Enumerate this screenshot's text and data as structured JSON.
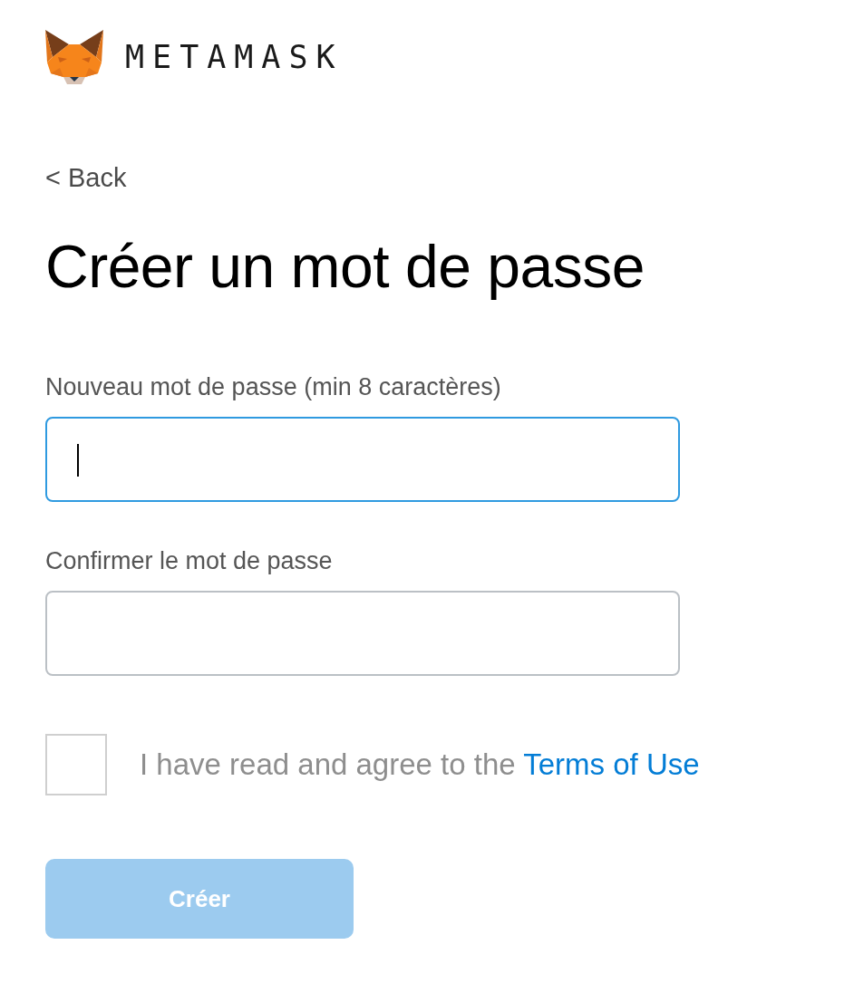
{
  "header": {
    "brand": "METAMASK"
  },
  "back_link": "< Back",
  "title": "Créer un mot de passe",
  "fields": [
    {
      "label": "Nouveau mot de passe (min 8 caractères)",
      "focused": true
    },
    {
      "label": "Confirmer le mot de passe",
      "focused": false
    }
  ],
  "terms": {
    "checked": false,
    "text": "I have read and agree to the ",
    "link": "Terms of Use"
  },
  "submit_button": {
    "label": "Créer",
    "disabled": true
  }
}
